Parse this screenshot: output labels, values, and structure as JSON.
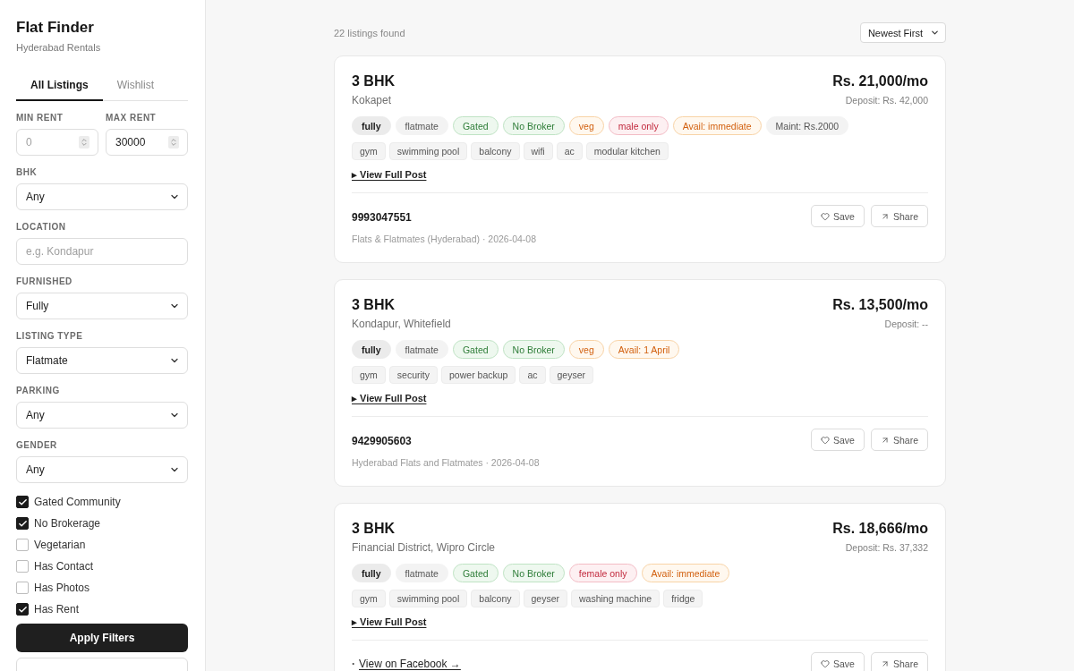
{
  "sidebar": {
    "title": "Flat Finder",
    "subtitle": "Hyderabad Rentals",
    "tabs": [
      {
        "label": "All Listings",
        "selected": true
      },
      {
        "label": "Wishlist",
        "selected": false
      }
    ],
    "rent_range": [
      {
        "label": "MIN RENT",
        "placeholder": "0"
      },
      {
        "label": "MAX RENT",
        "value": "30000"
      }
    ],
    "filters": [
      {
        "kind": "select",
        "label": "BHK",
        "value": "Any"
      },
      {
        "kind": "text",
        "label": "LOCATION",
        "placeholder": "e.g. Kondapur"
      },
      {
        "kind": "select",
        "label": "FURNISHED",
        "value": "Fully"
      },
      {
        "kind": "select",
        "label": "LISTING TYPE",
        "value": "Flatmate"
      },
      {
        "kind": "select",
        "label": "PARKING",
        "value": "Any"
      },
      {
        "kind": "select",
        "label": "GENDER",
        "value": "Any"
      }
    ],
    "checkboxes": [
      {
        "label": "Gated Community",
        "checked": true
      },
      {
        "label": "No Brokerage",
        "checked": true
      },
      {
        "label": "Vegetarian",
        "checked": false
      },
      {
        "label": "Has Contact",
        "checked": false
      },
      {
        "label": "Has Photos",
        "checked": false
      },
      {
        "label": "Has Rent",
        "checked": true
      }
    ],
    "apply_button": "Apply Filters"
  },
  "results": {
    "count": "22 listings found",
    "sort": "Newest First"
  },
  "listings": [
    {
      "title": "3 BHK",
      "location": "Kokapet",
      "price": "Rs. 21,000/mo",
      "deposit": "Deposit: Rs. 42,000",
      "tags": [
        {
          "label": "fully",
          "kind": "strong"
        },
        {
          "label": "flatmate",
          "kind": "plain"
        },
        {
          "label": "Gated",
          "kind": "positive"
        },
        {
          "label": "No Broker",
          "kind": "positive"
        },
        {
          "label": "veg",
          "kind": "caution"
        },
        {
          "label": "male only",
          "kind": "alert"
        },
        {
          "label": "Avail: immediate",
          "kind": "caution"
        },
        {
          "label": "Maint: Rs.2000",
          "kind": "plain"
        }
      ],
      "amenities": [
        "gym",
        "swimming pool",
        "balcony",
        "wifi",
        "ac",
        "modular kitchen"
      ],
      "details_link": "▸ View Full Post",
      "contact": "9993047551",
      "source": "Flats & Flatmates (Hyderabad) · 2026-04-08",
      "actions": [
        {
          "kind": "save",
          "label": "Save"
        },
        {
          "kind": "share",
          "label": "Share"
        }
      ]
    },
    {
      "title": "3 BHK",
      "location": "Kondapur, Whitefield",
      "price": "Rs. 13,500/mo",
      "deposit": "Deposit: --",
      "tags": [
        {
          "label": "fully",
          "kind": "strong"
        },
        {
          "label": "flatmate",
          "kind": "plain"
        },
        {
          "label": "Gated",
          "kind": "positive"
        },
        {
          "label": "No Broker",
          "kind": "positive"
        },
        {
          "label": "veg",
          "kind": "caution"
        },
        {
          "label": "Avail: 1 April",
          "kind": "caution"
        }
      ],
      "amenities": [
        "gym",
        "security",
        "power backup",
        "ac",
        "geyser"
      ],
      "details_link": "▸ View Full Post",
      "contact": "9429905603",
      "source": "Hyderabad Flats and Flatmates · 2026-04-08",
      "actions": [
        {
          "kind": "save",
          "label": "Save"
        },
        {
          "kind": "share",
          "label": "Share"
        }
      ]
    },
    {
      "title": "3 BHK",
      "location": "Financial District, Wipro Circle",
      "price": "Rs. 18,666/mo",
      "deposit": "Deposit: Rs. 37,332",
      "tags": [
        {
          "label": "fully",
          "kind": "strong"
        },
        {
          "label": "flatmate",
          "kind": "plain"
        },
        {
          "label": "Gated",
          "kind": "positive"
        },
        {
          "label": "No Broker",
          "kind": "positive"
        },
        {
          "label": "female only",
          "kind": "alert"
        },
        {
          "label": "Avail: immediate",
          "kind": "caution"
        }
      ],
      "amenities": [
        "gym",
        "swimming pool",
        "balcony",
        "geyser",
        "washing machine",
        "fridge"
      ],
      "details_link": "▸ View Full Post",
      "link_prefix": "·",
      "post_link": "View on Facebook →",
      "actions": [
        {
          "kind": "save",
          "label": "Save"
        },
        {
          "kind": "share",
          "label": "Share"
        }
      ]
    }
  ]
}
